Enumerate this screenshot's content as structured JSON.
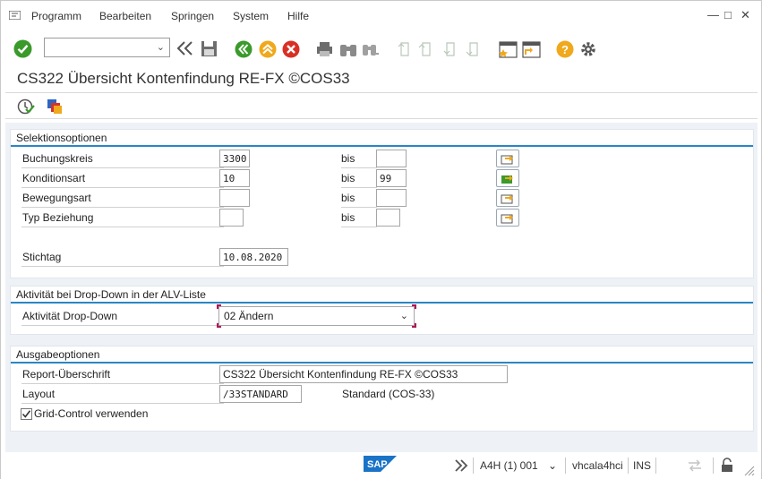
{
  "menu": {
    "items": [
      "Programm",
      "Bearbeiten",
      "Springen",
      "System",
      "Hilfe"
    ]
  },
  "window_controls": {
    "minimize": "—",
    "maximize": "□",
    "close": "✕"
  },
  "toolbar": {
    "command_field_value": "",
    "icons": [
      "enter-check-icon",
      "command-field",
      "collapse-icon",
      "save-icon",
      "back-icon",
      "exit-icon",
      "cancel-icon",
      "print-icon",
      "find-icon",
      "find-next-icon",
      "first-page-icon",
      "previous-page-icon",
      "next-page-icon",
      "last-page-icon",
      "create-session-icon",
      "shortcut-icon",
      "help-icon",
      "settings-icon"
    ],
    "colors": {
      "green": "#3a9a2b",
      "orange": "#f0a81c",
      "red": "#d93025",
      "help": "#f0a81c"
    }
  },
  "title": "CS322 Übersicht Kontenfindung RE-FX ©COS33",
  "app_toolbar": {
    "icons": [
      "execute-icon",
      "variants-icon"
    ]
  },
  "selektionsoptionen": {
    "title": "Selektionsoptionen",
    "rows": [
      {
        "label": "Buchungskreis",
        "from": "3300",
        "bis_label": "bis",
        "to": ""
      },
      {
        "label": "Konditionsart",
        "from": "10",
        "bis_label": "bis",
        "to": "99"
      },
      {
        "label": "Bewegungsart",
        "from": "",
        "bis_label": "bis",
        "to": ""
      },
      {
        "label": "Typ Beziehung",
        "from": "",
        "bis_label": "bis",
        "to": ""
      }
    ],
    "stichtag_label": "Stichtag",
    "stichtag_value": "10.08.2020"
  },
  "aktivitaet": {
    "title": "Aktivität bei Drop-Down in der ALV-Liste",
    "label": "Aktivität Drop-Down",
    "value": "02 Ändern"
  },
  "ausgabeoptionen": {
    "title": "Ausgabeoptionen",
    "report_label": "Report-Überschrift",
    "report_value": "CS322 Übersicht Kontenfindung RE-FX ©COS33",
    "layout_label": "Layout",
    "layout_value": "/33STANDARD",
    "layout_description": "Standard (COS-33)",
    "grid_label": "Grid-Control verwenden",
    "grid_checked": true
  },
  "statusbar": {
    "logo": "SAP",
    "system": "A4H (1) 001",
    "server": "vhcala4hci",
    "mode": "INS"
  }
}
